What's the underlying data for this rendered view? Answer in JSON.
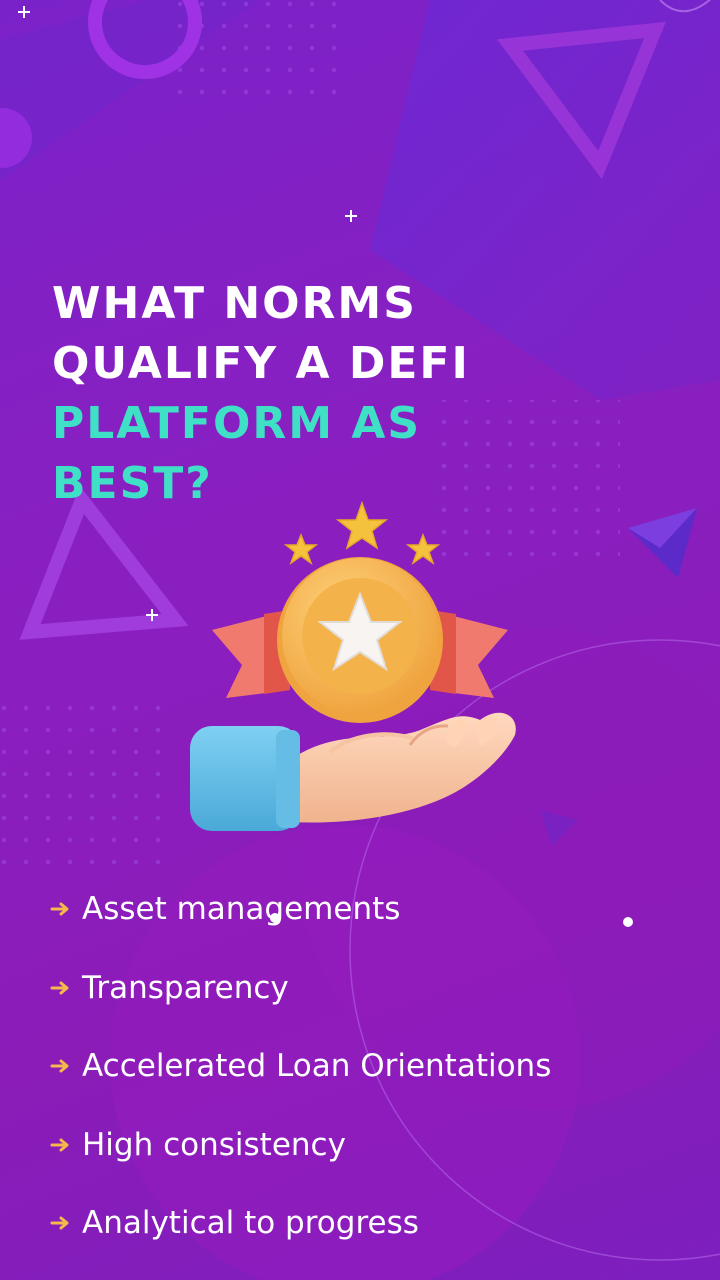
{
  "headline": {
    "line1": "WHAT NORMS",
    "line2": "QUALIFY A DEFI",
    "line3": "PLATFORM AS",
    "line4": "BEST?"
  },
  "colors": {
    "accent": "#3fe0c5",
    "arrow": "#f5b84a",
    "background": "#8a1fc0"
  },
  "illustration": {
    "icon": "hand-holding-star-medal-icon",
    "stars_above": 3
  },
  "features": [
    {
      "label": "Asset managements"
    },
    {
      "label": "Transparency"
    },
    {
      "label": "Accelerated Loan Orientations"
    },
    {
      "label": "High consistency"
    },
    {
      "label": "Analytical to progress"
    }
  ]
}
